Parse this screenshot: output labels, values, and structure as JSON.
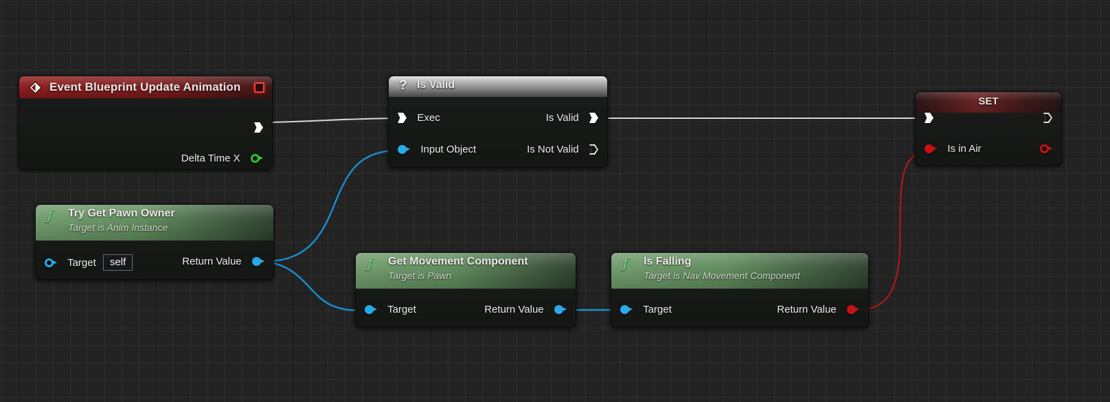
{
  "app": {
    "kind": "blueprint-graph",
    "title": "Event Graph"
  },
  "colors": {
    "exec_white": "#ffffff",
    "object_blue": "#2aa9e8",
    "bool_red": "#c81212",
    "float_green": "#2fc12f",
    "node_body": "#171917",
    "event_header": "#8d1b1b",
    "function_header": "#5e8a5b",
    "isvalid_header": "#9a9a9a",
    "set_header": "#6a2323",
    "canvas": "#232323"
  },
  "nodes": {
    "event_update_animation": {
      "title": "Event Blueprint Update Animation",
      "icon": "event-diamond-icon",
      "close_icon": "breakpoint-stop-icon",
      "outputs": [
        {
          "label": "",
          "pin": "exec-pin"
        },
        {
          "label": "Delta Time X",
          "pin": "float-pin"
        }
      ]
    },
    "is_valid": {
      "title": "Is Valid",
      "icon": "question-mark-icon",
      "inputs": [
        {
          "label": "Exec",
          "pin": "exec-pin"
        },
        {
          "label": "Input Object",
          "pin": "object-pin"
        }
      ],
      "outputs": [
        {
          "label": "Is Valid",
          "pin": "exec-pin"
        },
        {
          "label": "Is Not Valid",
          "pin": "exec-pin-hollow"
        }
      ]
    },
    "set_is_in_air": {
      "title": "SET",
      "inputs": [
        {
          "label": "",
          "pin": "exec-pin"
        },
        {
          "label": "Is in Air",
          "pin": "bool-pin"
        }
      ],
      "outputs": [
        {
          "label": "",
          "pin": "exec-pin-hollow"
        },
        {
          "label": "",
          "pin": "bool-pin"
        }
      ]
    },
    "try_get_pawn_owner": {
      "title": "Try Get Pawn Owner",
      "subtitle": "Target is Anim Instance",
      "icon": "function-f-icon",
      "inputs": [
        {
          "label": "Target",
          "pin": "object-ref-pin",
          "value": "self"
        }
      ],
      "outputs": [
        {
          "label": "Return Value",
          "pin": "object-pin"
        }
      ]
    },
    "get_movement_component": {
      "title": "Get Movement Component",
      "subtitle": "Target is Pawn",
      "icon": "function-f-icon",
      "inputs": [
        {
          "label": "Target",
          "pin": "object-pin"
        }
      ],
      "outputs": [
        {
          "label": "Return Value",
          "pin": "object-pin"
        }
      ]
    },
    "is_falling": {
      "title": "Is Falling",
      "subtitle": "Target is Nav Movement Component",
      "icon": "function-f-icon",
      "inputs": [
        {
          "label": "Target",
          "pin": "object-pin"
        }
      ],
      "outputs": [
        {
          "label": "Return Value",
          "pin": "bool-pin"
        }
      ]
    }
  },
  "wires": [
    {
      "name": "exec-event-to-isvalid",
      "type": "exec",
      "color": "#d6d6d6"
    },
    {
      "name": "exec-isvalid-to-set",
      "type": "exec",
      "color": "#d6d6d6"
    },
    {
      "name": "data-pawnowner-to-isvalid-input",
      "type": "object",
      "color": "#1a8fd0"
    },
    {
      "name": "data-pawnowner-to-movementcomponent-target",
      "type": "object",
      "color": "#1a8fd0"
    },
    {
      "name": "data-movementcomponent-to-isfalling-target",
      "type": "object",
      "color": "#1a8fd0"
    },
    {
      "name": "data-isfalling-to-set-isinair",
      "type": "bool",
      "color": "#b01818"
    }
  ]
}
